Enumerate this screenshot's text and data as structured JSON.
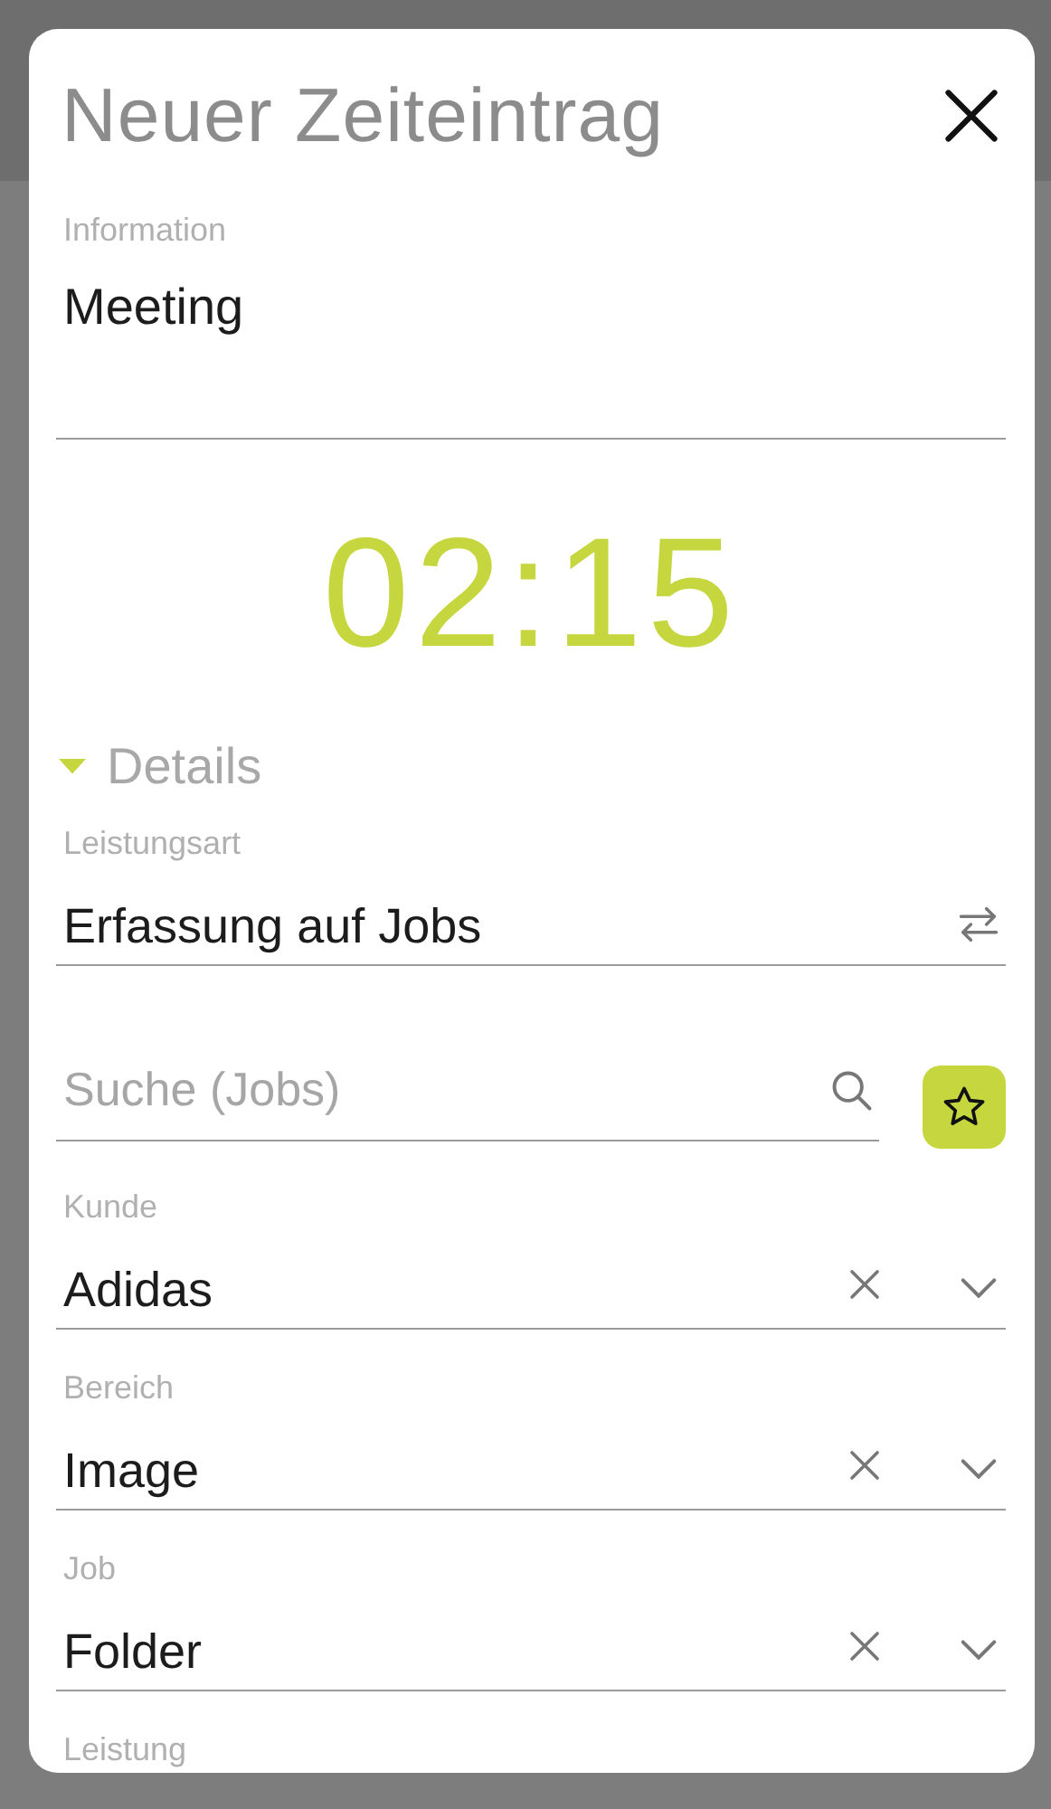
{
  "dialog": {
    "title": "Neuer Zeiteintrag"
  },
  "information": {
    "label": "Information",
    "value": "Meeting"
  },
  "duration": "02:15",
  "details": {
    "label": "Details",
    "expanded": true
  },
  "fields": [
    {
      "kind": "switch",
      "label": "Leistungsart",
      "value": "Erfassung auf Jobs"
    },
    {
      "kind": "search",
      "placeholder": "Suche (Jobs)"
    },
    {
      "kind": "combo",
      "label": "Kunde",
      "value": "Adidas"
    },
    {
      "kind": "combo",
      "label": "Bereich",
      "value": "Image"
    },
    {
      "kind": "combo",
      "label": "Job",
      "value": "Folder"
    },
    {
      "kind": "label",
      "label": "Leistung"
    }
  ]
}
